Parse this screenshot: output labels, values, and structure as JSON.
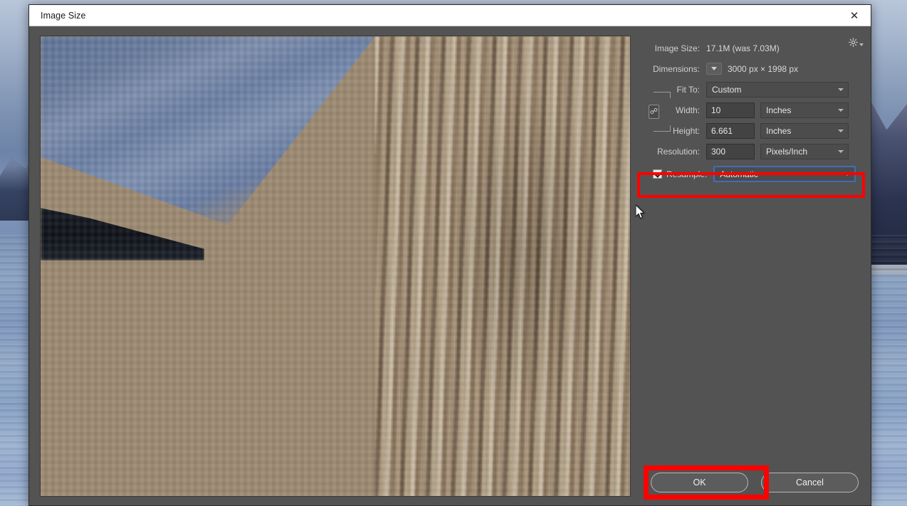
{
  "window": {
    "title": "Image Size",
    "close_icon": "close-icon"
  },
  "settings": {
    "image_size": {
      "label": "Image Size:",
      "value": "17.1M (was 7.03M)"
    },
    "gear_icon": "gear-icon",
    "dimensions": {
      "label": "Dimensions:",
      "chevron_icon": "chevron-down-icon",
      "value": "3000 px  ×  1998 px"
    },
    "fit_to": {
      "label": "Fit To:",
      "value": "Custom"
    },
    "link_icon": "chain-link-icon",
    "width": {
      "label": "Width:",
      "value": "10",
      "unit": "Inches"
    },
    "height": {
      "label": "Height:",
      "value": "6.661",
      "unit": "Inches"
    },
    "resolution": {
      "label": "Resolution:",
      "value": "300",
      "unit": "Pixels/Inch"
    },
    "resample": {
      "label": "Resample:",
      "checked": true,
      "value": "Automatic"
    }
  },
  "footer": {
    "ok_label": "OK",
    "cancel_label": "Cancel"
  },
  "annotations": {
    "highlight_color": "#ff0000",
    "focus_color": "#3f6fb5"
  }
}
